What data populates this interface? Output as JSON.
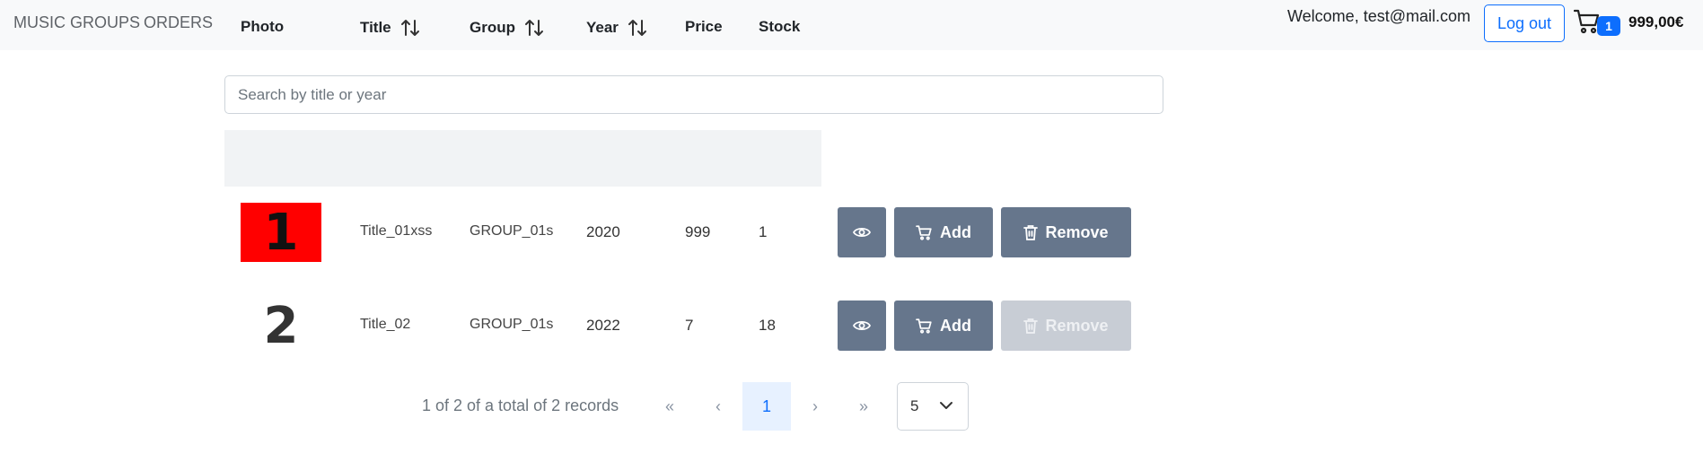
{
  "nav": {
    "items": [
      {
        "label": "MUSIC GROUPS"
      },
      {
        "label": "ORDERS"
      }
    ],
    "welcome": "Welcome, test@mail.com",
    "logout_label": "Log out",
    "cart_count": "1",
    "cart_total": "999,00€"
  },
  "search": {
    "placeholder": "Search by title or year",
    "value": ""
  },
  "table": {
    "headers": {
      "photo": "Photo",
      "title": "Title",
      "group": "Group",
      "year": "Year",
      "price": "Price",
      "stock": "Stock"
    },
    "rows": [
      {
        "photo_text": "1",
        "title": "Title_01xss",
        "group": "GROUP_01s",
        "year": "2020",
        "price": "999",
        "stock": "1",
        "remove_enabled": true
      },
      {
        "photo_text": "2",
        "title": "Title_02",
        "group": "GROUP_01s",
        "year": "2022",
        "price": "7",
        "stock": "18",
        "remove_enabled": false
      }
    ],
    "actions": {
      "view_icon": "eye-icon",
      "add_label": "Add",
      "remove_label": "Remove"
    }
  },
  "pagination": {
    "info": "1 of 2 of a total of 2 records",
    "first": "«",
    "prev": "‹",
    "current_page": "1",
    "next": "›",
    "last": "»",
    "page_size": "5"
  },
  "colors": {
    "accent": "#0d6efd",
    "action_button": "#66768c",
    "action_button_disabled": "#c8cdd5",
    "photo_1_background": "#ff0000"
  }
}
